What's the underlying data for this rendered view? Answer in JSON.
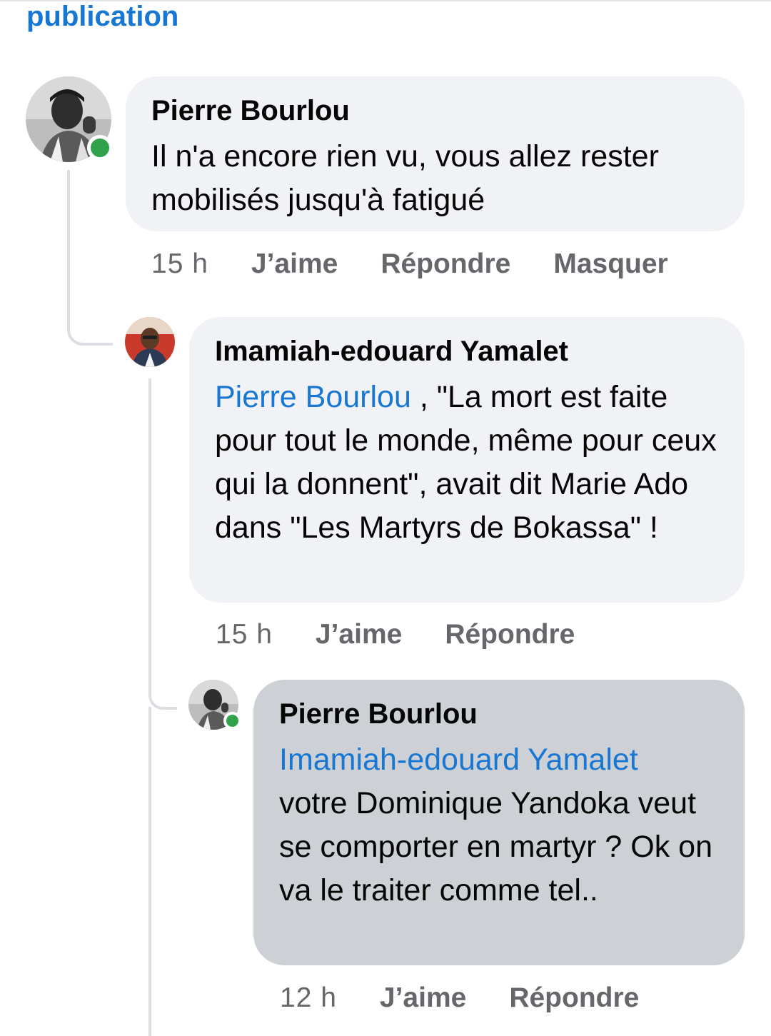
{
  "header": {
    "link": "publication"
  },
  "comments": [
    {
      "author": "Pierre Bourlou",
      "text": "Il n'a encore rien vu, vous allez rester mobilisés jusqu'à fatigué",
      "time": "15 h",
      "actions": {
        "like": "J’aime",
        "reply": "Répondre",
        "hide": "Masquer"
      },
      "online": true
    },
    {
      "author": "Imamiah-edouard Yamalet",
      "mention": "Pierre Bourlou",
      "text": " , \"La mort est faite pour tout le monde, même pour ceux qui la donnent\", avait dit Marie Ado dans \"Les Martyrs de Bokassa\" !",
      "time": "15 h",
      "actions": {
        "like": "J’aime",
        "reply": "Répondre"
      }
    },
    {
      "author": "Pierre Bourlou",
      "mention": "Imamiah-edouard Yamalet",
      "text": "votre Dominique Yandoka veut se comporter en martyr ? Ok on va le traiter comme tel..",
      "time": "12 h",
      "actions": {
        "like": "J’aime",
        "reply": "Répondre"
      },
      "online": true
    }
  ],
  "colors": {
    "link_blue": "#1877d2",
    "bubble": "#f0f2f5",
    "bubble_selected": "#cdd0d4",
    "online": "#31a24c",
    "meta_text": "#65676b"
  }
}
